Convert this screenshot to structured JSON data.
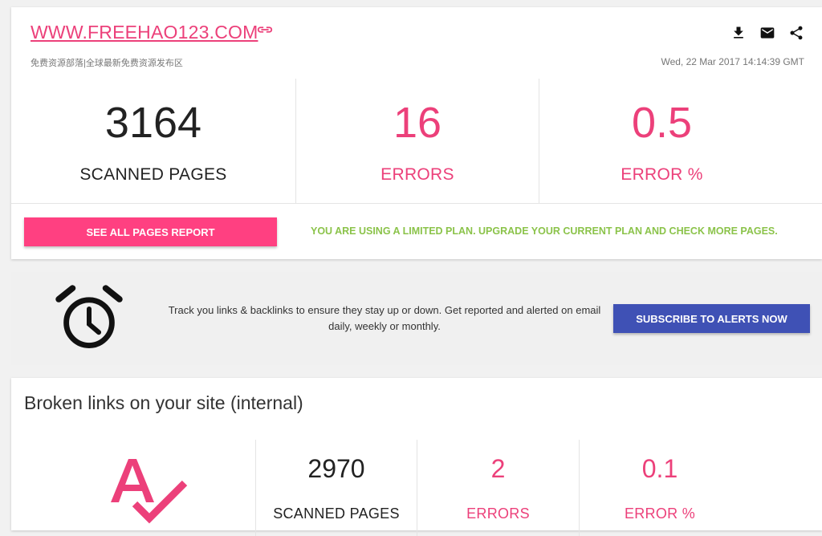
{
  "header": {
    "site_url": "WWW.FREEHAO123.COM",
    "site_subtitle": "免费资源部落|全球最新免费资源发布区",
    "timestamp": "Wed, 22 Mar 2017 14:14:39 GMT",
    "icons": [
      "link-icon",
      "download-icon",
      "email-icon",
      "share-icon"
    ]
  },
  "summary": {
    "scanned_pages": {
      "value": "3164",
      "label": "SCANNED PAGES"
    },
    "errors": {
      "value": "16",
      "label": "ERRORS"
    },
    "error_pct": {
      "value": "0.5",
      "label": "ERROR %"
    }
  },
  "actions": {
    "see_all_label": "SEE ALL PAGES REPORT",
    "plan_notice": "YOU ARE USING A LIMITED PLAN. UPGRADE YOUR CURRENT PLAN AND CHECK MORE PAGES."
  },
  "alerts": {
    "text": "Track you links & backlinks to ensure they stay up or down. Get reported and alerted on email daily, weekly or monthly.",
    "subscribe_label": "SUBSCRIBE TO ALERTS NOW"
  },
  "broken_links": {
    "title": "Broken links on your site (internal)",
    "scanned_pages": {
      "value": "2970",
      "label": "SCANNED PAGES"
    },
    "errors": {
      "value": "2",
      "label": "ERRORS"
    },
    "error_pct": {
      "value": "0.1",
      "label": "ERROR %"
    }
  },
  "colors": {
    "accent_pink": "#ff4081",
    "accent_blue": "#3f51b5",
    "notice_green": "#8bc34a"
  }
}
